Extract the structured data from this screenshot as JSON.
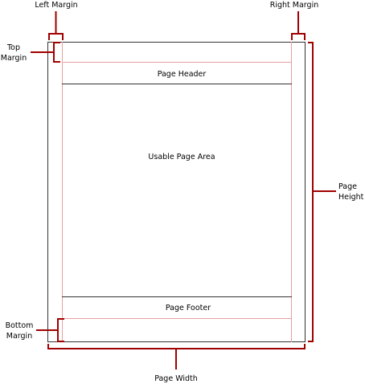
{
  "labels": {
    "left_margin": "Left Margin",
    "right_margin": "Right Margin",
    "top_margin": [
      "Top",
      "Margin"
    ],
    "bottom_margin": [
      "Bottom",
      "Margin"
    ],
    "page_height": [
      "Page",
      "Height"
    ],
    "page_width": "Page Width",
    "page_header": "Page Header",
    "usable_area": "Usable Page Area",
    "page_footer": "Page Footer"
  },
  "colors": {
    "page_outline": "#333333",
    "margin_guides": "#e8a0a0",
    "dimension_brackets": "#a00000",
    "text": "#000000"
  }
}
